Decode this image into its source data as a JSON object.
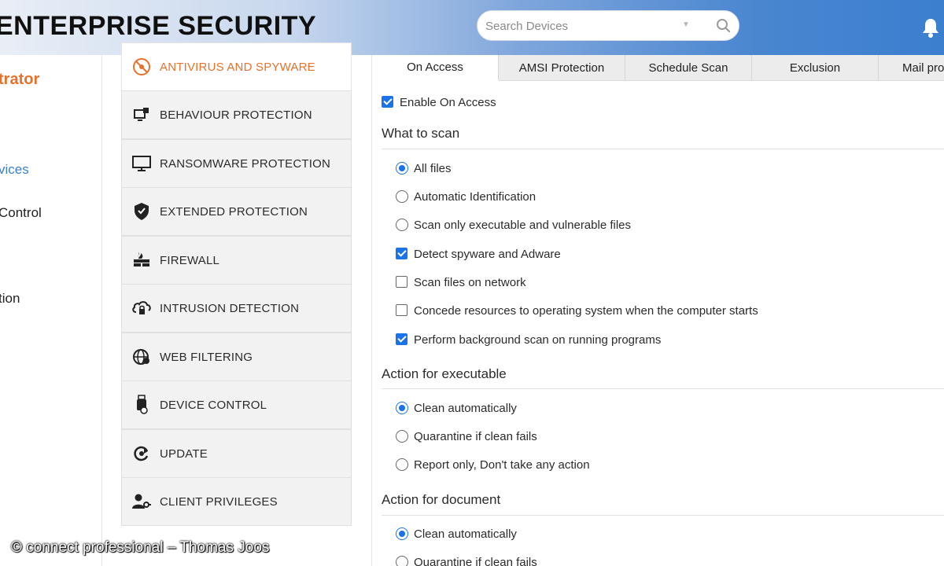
{
  "header": {
    "app_title": "ENTERPRISE SECURITY",
    "search_placeholder": "Search Devices"
  },
  "left_nav": {
    "role": "trator",
    "items": [
      "vices",
      "Control",
      "tion"
    ],
    "active_index": 0
  },
  "categories": [
    {
      "label": "ANTIVIRUS AND SPYWARE",
      "icon": "antivirus-icon",
      "active": true
    },
    {
      "label": "BEHAVIOUR PROTECTION",
      "icon": "behaviour-icon"
    },
    {
      "label": "RANSOMWARE PROTECTION",
      "icon": "monitor-icon"
    },
    {
      "label": "EXTENDED PROTECTION",
      "icon": "shield-icon"
    },
    {
      "label": "FIREWALL",
      "icon": "firewall-icon"
    },
    {
      "label": "INTRUSION DETECTION",
      "icon": "cloud-lock-icon"
    },
    {
      "label": "WEB FILTERING",
      "icon": "globe-icon"
    },
    {
      "label": "DEVICE CONTROL",
      "icon": "usb-icon"
    },
    {
      "label": "UPDATE",
      "icon": "refresh-icon"
    },
    {
      "label": "CLIENT PRIVILEGES",
      "icon": "user-key-icon"
    }
  ],
  "tabs": [
    {
      "label": "On Access",
      "active": true
    },
    {
      "label": "AMSI Protection"
    },
    {
      "label": "Schedule Scan"
    },
    {
      "label": "Exclusion"
    },
    {
      "label": "Mail pro"
    }
  ],
  "on_access": {
    "enable_label": "Enable On Access",
    "enable_checked": true,
    "what_to_scan": {
      "title": "What to scan",
      "radios": [
        {
          "label": "All files",
          "checked": true
        },
        {
          "label": "Automatic Identification",
          "checked": false
        },
        {
          "label": "Scan only executable and vulnerable files",
          "checked": false
        }
      ],
      "checkboxes": [
        {
          "label": "Detect spyware and Adware",
          "checked": true
        },
        {
          "label": "Scan files on network",
          "checked": false
        },
        {
          "label": "Concede resources to operating system when the computer starts",
          "checked": false
        },
        {
          "label": "Perform background scan on running programs",
          "checked": true
        }
      ]
    },
    "action_executable": {
      "title": "Action for executable",
      "radios": [
        {
          "label": "Clean automatically",
          "checked": true
        },
        {
          "label": "Quarantine if clean fails",
          "checked": false
        },
        {
          "label": "Report only, Don't take any action",
          "checked": false
        }
      ]
    },
    "action_document": {
      "title": "Action for document",
      "radios": [
        {
          "label": "Clean automatically",
          "checked": true
        },
        {
          "label": "Quarantine if clean fails",
          "checked": false
        }
      ]
    }
  },
  "watermark": "© connect professional – Thomas Joos",
  "colors": {
    "accent": "#e8712b",
    "link": "#3b7fcf",
    "check": "#1a73e8"
  }
}
